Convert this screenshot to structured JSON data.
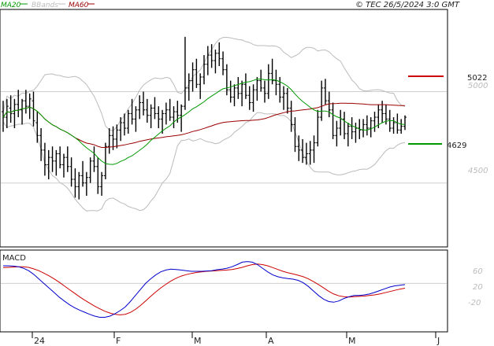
{
  "header": {
    "watermark": "© TEC 26/5/2024 3:0 GMT"
  },
  "legend": [
    {
      "label": "MA20",
      "color": "#009900"
    },
    {
      "label": "BBands",
      "color": "#bbbbbb"
    },
    {
      "label": "MA60",
      "color": "#990000"
    }
  ],
  "macd_panel": {
    "title": "MACD"
  },
  "levels": [
    {
      "label": "5022",
      "value": 5022,
      "color": "#cc0000"
    },
    {
      "label": "4629",
      "value": 4629,
      "color": "#009900"
    }
  ],
  "price_axis": {
    "ticks": [
      "5000",
      "4500"
    ]
  },
  "macd_axis": {
    "ticks": [
      "60",
      "20",
      "-20"
    ]
  },
  "months": [
    "24",
    "F",
    "M",
    "A",
    "M",
    "J"
  ],
  "chart_data": {
    "type": "line",
    "price_ylim": [
      4150,
      5450
    ],
    "macd_ylim": [
      -160,
      110
    ],
    "candles": [
      [
        4890,
        4950,
        4780,
        4860
      ],
      [
        4860,
        4960,
        4800,
        4920
      ],
      [
        4910,
        4980,
        4830,
        4880
      ],
      [
        4880,
        4960,
        4800,
        4930
      ],
      [
        4930,
        5010,
        4860,
        4900
      ],
      [
        4900,
        4960,
        4820,
        4950
      ],
      [
        4950,
        5010,
        4880,
        4920
      ],
      [
        4920,
        4990,
        4850,
        4960
      ],
      [
        4950,
        5000,
        4810,
        4840
      ],
      [
        4830,
        4890,
        4720,
        4760
      ],
      [
        4760,
        4800,
        4620,
        4680
      ],
      [
        4680,
        4720,
        4540,
        4600
      ],
      [
        4600,
        4680,
        4520,
        4640
      ],
      [
        4640,
        4700,
        4560,
        4620
      ],
      [
        4620,
        4680,
        4540,
        4660
      ],
      [
        4660,
        4700,
        4580,
        4600
      ],
      [
        4600,
        4660,
        4530,
        4640
      ],
      [
        4640,
        4700,
        4560,
        4590
      ],
      [
        4590,
        4640,
        4480,
        4520
      ],
      [
        4520,
        4580,
        4420,
        4480
      ],
      [
        4480,
        4560,
        4410,
        4540
      ],
      [
        4540,
        4620,
        4480,
        4500
      ],
      [
        4500,
        4560,
        4430,
        4530
      ],
      [
        4530,
        4640,
        4500,
        4620
      ],
      [
        4620,
        4700,
        4560,
        4590
      ],
      [
        4590,
        4640,
        4440,
        4480
      ],
      [
        4480,
        4560,
        4430,
        4540
      ],
      [
        4540,
        4720,
        4520,
        4700
      ],
      [
        4700,
        4800,
        4660,
        4760
      ],
      [
        4760,
        4810,
        4680,
        4740
      ],
      [
        4740,
        4820,
        4690,
        4790
      ],
      [
        4790,
        4860,
        4730,
        4830
      ],
      [
        4830,
        4880,
        4760,
        4800
      ],
      [
        4800,
        4900,
        4770,
        4880
      ],
      [
        4880,
        4960,
        4820,
        4850
      ],
      [
        4850,
        4920,
        4780,
        4900
      ],
      [
        4900,
        4980,
        4850,
        4940
      ],
      [
        4940,
        5000,
        4870,
        4900
      ],
      [
        4900,
        4960,
        4830,
        4870
      ],
      [
        4870,
        4930,
        4800,
        4910
      ],
      [
        4910,
        4970,
        4850,
        4880
      ],
      [
        4880,
        4920,
        4800,
        4850
      ],
      [
        4850,
        4900,
        4770,
        4880
      ],
      [
        4880,
        4940,
        4820,
        4900
      ],
      [
        4900,
        4960,
        4840,
        4860
      ],
      [
        4860,
        4920,
        4800,
        4890
      ],
      [
        4890,
        4950,
        4830,
        4870
      ],
      [
        4870,
        4930,
        4780,
        4920
      ],
      [
        4920,
        5300,
        4900,
        5020
      ],
      [
        5020,
        5100,
        4950,
        5060
      ],
      [
        5060,
        5160,
        5000,
        5120
      ],
      [
        5120,
        5180,
        5020,
        5040
      ],
      [
        5040,
        5100,
        4960,
        5080
      ],
      [
        5080,
        5200,
        5040,
        5150
      ],
      [
        5150,
        5250,
        5090,
        5200
      ],
      [
        5200,
        5260,
        5130,
        5170
      ],
      [
        5170,
        5230,
        5100,
        5210
      ],
      [
        5210,
        5270,
        5140,
        5180
      ],
      [
        5180,
        5220,
        5090,
        5120
      ],
      [
        5120,
        5150,
        4980,
        5010
      ],
      [
        5010,
        5060,
        4940,
        4970
      ],
      [
        4970,
        5040,
        4920,
        5020
      ],
      [
        5020,
        5080,
        4960,
        4990
      ],
      [
        4990,
        5060,
        4920,
        5040
      ],
      [
        5040,
        5100,
        4960,
        4980
      ],
      [
        4980,
        5030,
        4900,
        4940
      ],
      [
        4940,
        5040,
        4890,
        5010
      ],
      [
        5010,
        5080,
        4950,
        5060
      ],
      [
        5060,
        5120,
        5000,
        5020
      ],
      [
        5020,
        5060,
        4940,
        4990
      ],
      [
        4990,
        5150,
        4960,
        5100
      ],
      [
        5100,
        5180,
        5040,
        5060
      ],
      [
        5060,
        5120,
        4980,
        5040
      ],
      [
        5040,
        5080,
        4940,
        4970
      ],
      [
        4970,
        5030,
        4900,
        4990
      ],
      [
        4990,
        5020,
        4880,
        4910
      ],
      [
        4910,
        4950,
        4780,
        4820
      ],
      [
        4820,
        4860,
        4670,
        4700
      ],
      [
        4700,
        4760,
        4620,
        4680
      ],
      [
        4680,
        4740,
        4610,
        4640
      ],
      [
        4640,
        4720,
        4600,
        4660
      ],
      [
        4660,
        4730,
        4600,
        4680
      ],
      [
        4680,
        4760,
        4610,
        4720
      ],
      [
        4720,
        4900,
        4700,
        4860
      ],
      [
        4860,
        5060,
        4840,
        5020
      ],
      [
        5020,
        5070,
        4930,
        4950
      ],
      [
        4950,
        5000,
        4860,
        4900
      ],
      [
        4900,
        4940,
        4740,
        4760
      ],
      [
        4760,
        4840,
        4700,
        4800
      ],
      [
        4800,
        4900,
        4760,
        4850
      ],
      [
        4850,
        4890,
        4740,
        4770
      ],
      [
        4770,
        4830,
        4700,
        4810
      ],
      [
        4810,
        4860,
        4740,
        4780
      ],
      [
        4780,
        4830,
        4720,
        4800
      ],
      [
        4800,
        4850,
        4740,
        4790
      ],
      [
        4790,
        4850,
        4750,
        4820
      ],
      [
        4820,
        4870,
        4760,
        4800
      ],
      [
        4800,
        4860,
        4750,
        4840
      ],
      [
        4840,
        4890,
        4780,
        4860
      ],
      [
        4860,
        4930,
        4800,
        4900
      ],
      [
        4900,
        4950,
        4830,
        4880
      ],
      [
        4880,
        4930,
        4820,
        4850
      ],
      [
        4850,
        4900,
        4780,
        4800
      ],
      [
        4800,
        4860,
        4770,
        4830
      ],
      [
        4830,
        4880,
        4770,
        4790
      ],
      [
        4790,
        4850,
        4770,
        4810
      ],
      [
        4810,
        4870,
        4790,
        4860
      ]
    ],
    "macd": [
      [
        58,
        52
      ],
      [
        58,
        53
      ],
      [
        57,
        54
      ],
      [
        55,
        55
      ],
      [
        50,
        55
      ],
      [
        42,
        53
      ],
      [
        30,
        48
      ],
      [
        15,
        42
      ],
      [
        0,
        34
      ],
      [
        -15,
        25
      ],
      [
        -30,
        15
      ],
      [
        -45,
        4
      ],
      [
        -58,
        -8
      ],
      [
        -70,
        -20
      ],
      [
        -80,
        -32
      ],
      [
        -88,
        -44
      ],
      [
        -95,
        -55
      ],
      [
        -102,
        -65
      ],
      [
        -108,
        -75
      ],
      [
        -112,
        -84
      ],
      [
        -112,
        -92
      ],
      [
        -108,
        -98
      ],
      [
        -100,
        -102
      ],
      [
        -90,
        -104
      ],
      [
        -78,
        -102
      ],
      [
        -60,
        -96
      ],
      [
        -40,
        -86
      ],
      [
        -20,
        -73
      ],
      [
        0,
        -58
      ],
      [
        15,
        -43
      ],
      [
        28,
        -28
      ],
      [
        38,
        -15
      ],
      [
        44,
        -3
      ],
      [
        47,
        8
      ],
      [
        46,
        17
      ],
      [
        44,
        24
      ],
      [
        42,
        29
      ],
      [
        40,
        33
      ],
      [
        40,
        36
      ],
      [
        40,
        38
      ],
      [
        41,
        40
      ],
      [
        42,
        41
      ],
      [
        45,
        42
      ],
      [
        47,
        43
      ],
      [
        50,
        44
      ],
      [
        55,
        46
      ],
      [
        62,
        49
      ],
      [
        70,
        53
      ],
      [
        72,
        58
      ],
      [
        70,
        62
      ],
      [
        62,
        64
      ],
      [
        50,
        62
      ],
      [
        38,
        58
      ],
      [
        28,
        52
      ],
      [
        22,
        46
      ],
      [
        18,
        40
      ],
      [
        16,
        35
      ],
      [
        14,
        31
      ],
      [
        10,
        27
      ],
      [
        2,
        22
      ],
      [
        -10,
        15
      ],
      [
        -25,
        6
      ],
      [
        -40,
        -4
      ],
      [
        -52,
        -15
      ],
      [
        -60,
        -26
      ],
      [
        -62,
        -35
      ],
      [
        -58,
        -41
      ],
      [
        -50,
        -44
      ],
      [
        -44,
        -45
      ],
      [
        -40,
        -44
      ],
      [
        -40,
        -43
      ],
      [
        -38,
        -42
      ],
      [
        -35,
        -40
      ],
      [
        -30,
        -38
      ],
      [
        -24,
        -35
      ],
      [
        -18,
        -31
      ],
      [
        -12,
        -27
      ],
      [
        -8,
        -23
      ],
      [
        -6,
        -19
      ],
      [
        -4,
        -16
      ]
    ]
  }
}
